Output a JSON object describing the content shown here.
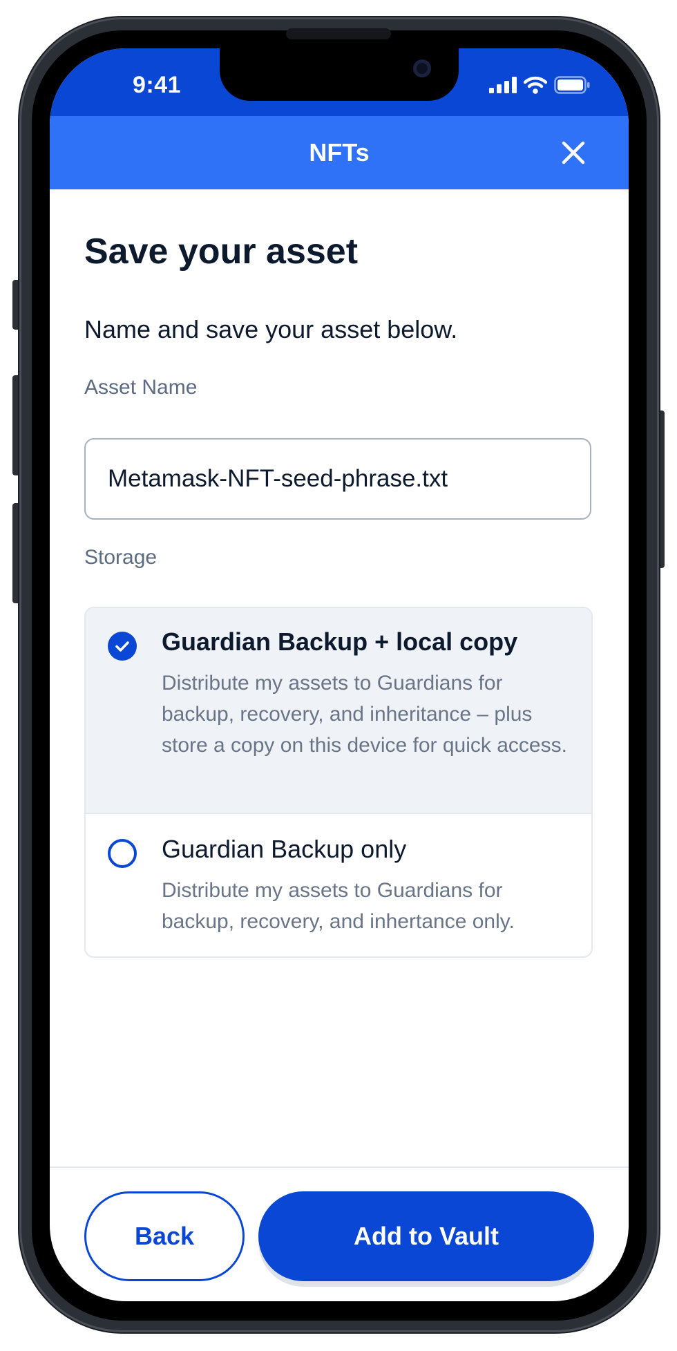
{
  "status_bar": {
    "time": "9:41"
  },
  "header": {
    "title": "NFTs",
    "close_icon": "close-icon"
  },
  "page": {
    "title": "Save your asset",
    "subtitle": "Name and save your asset below."
  },
  "asset_name": {
    "label": "Asset Name",
    "value": "Metamask-NFT-seed-phrase.txt"
  },
  "storage": {
    "label": "Storage",
    "selected_option": "Guardian Backup + local copy",
    "options": [
      {
        "title": "Guardian Backup + local copy",
        "description": "Distribute my assets to Guardians for backup, recovery, and inheritance – plus store a copy on this device for quick access.",
        "selected": true
      },
      {
        "title": "Guardian Backup only",
        "description": "Distribute my assets to Guardians for backup, recovery, and inhertance only.",
        "selected": false
      }
    ]
  },
  "footer": {
    "back_label": "Back",
    "add_label": "Add to Vault"
  },
  "colors": {
    "status_bar": "#0a47d4",
    "header": "#2f72f7",
    "primary": "#0a47d4",
    "selected_option_bg": "#eff3f8",
    "text_dark": "#0d1a2e",
    "text_muted": "#697587"
  }
}
